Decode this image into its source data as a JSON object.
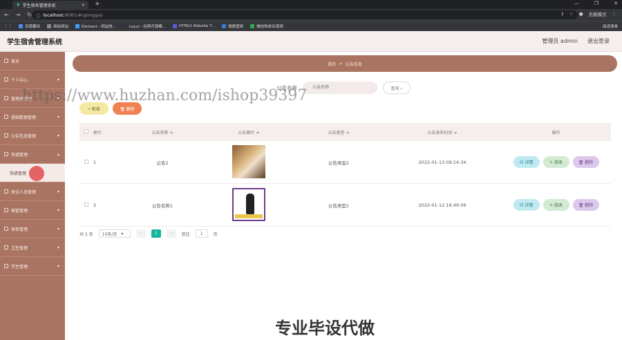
{
  "browser": {
    "tab_title": "学生宿舍管理系统",
    "tab_close": "×",
    "new_tab": "+",
    "window_controls": [
      "—",
      "❐",
      "✕"
    ],
    "url_host": "localhost",
    "url_path": ":8081/#/gonggao",
    "profile": "无痕模式",
    "bookmarks": [
      "百度翻译",
      "商标网站",
      "Element - 网站快...",
      "Layui - 经典开源模...",
      "HTML5 Website T...",
      "搜索壁纸",
      "微信购单名观测"
    ],
    "bookmark_colors": [
      "#4a8af4",
      "#888888",
      "#409eff",
      "#2f3542",
      "#5b5bd6",
      "#3a7bd5",
      "#2fa84f"
    ],
    "reading_list": "阅读清单"
  },
  "app": {
    "title": "学生宿舍管理系统",
    "admin_label": "管理员 admin",
    "logout": "退出登录"
  },
  "sidebar": {
    "items": [
      {
        "label": "首页",
        "has_children": false
      },
      {
        "label": "个人中心",
        "has_children": true
      },
      {
        "label": "管理员管理",
        "has_children": true
      },
      {
        "label": "基础数据管理",
        "has_children": true
      },
      {
        "label": "公告信息管理",
        "has_children": true
      },
      {
        "label": "快递管理",
        "has_children": true
      },
      {
        "label": "快递管理",
        "has_children": false,
        "sub": true
      },
      {
        "label": "来访人员管理",
        "has_children": true
      },
      {
        "label": "宿管管理",
        "has_children": true
      },
      {
        "label": "宿舍管理",
        "has_children": true
      },
      {
        "label": "卫生管理",
        "has_children": true
      },
      {
        "label": "学生管理",
        "has_children": true
      }
    ],
    "chevron": "▾",
    "colors": {
      "bg": "#a97562",
      "active": "#f4ebe9"
    }
  },
  "breadcrumb": {
    "home": "首页",
    "current": "公告信息"
  },
  "search": {
    "label": "公告名称",
    "placeholder": "公告名称",
    "button": "查询 ○"
  },
  "actions": {
    "add": "+ 新增",
    "delete": "🗑 删除"
  },
  "table": {
    "headers": [
      "",
      "索引",
      "公告名称 ≑",
      "公告图片 ≑",
      "公告类型 ≑",
      "公告发布时间 ≑",
      "操作"
    ],
    "rows": [
      {
        "index": "1",
        "name": "公告2",
        "type": "公告类型2",
        "time": "2022-01-13 09:14:34"
      },
      {
        "index": "2",
        "name": "公告名称1",
        "type": "公告类型1",
        "time": "2022-01-12 16:49:09"
      }
    ],
    "ops": {
      "detail": "▤ 详情",
      "edit": "✎ 修改",
      "remove": "🗑 删除"
    }
  },
  "pager": {
    "total": "共 2 条",
    "per_page": "10条/页",
    "prev": "‹",
    "current": "1",
    "next": "›",
    "goto": "前往",
    "goto_value": "1",
    "page_suffix": "页"
  },
  "overlay": {
    "watermark": "https://www.huzhan.com/ishop39397",
    "footer": "专业毕设代做"
  }
}
